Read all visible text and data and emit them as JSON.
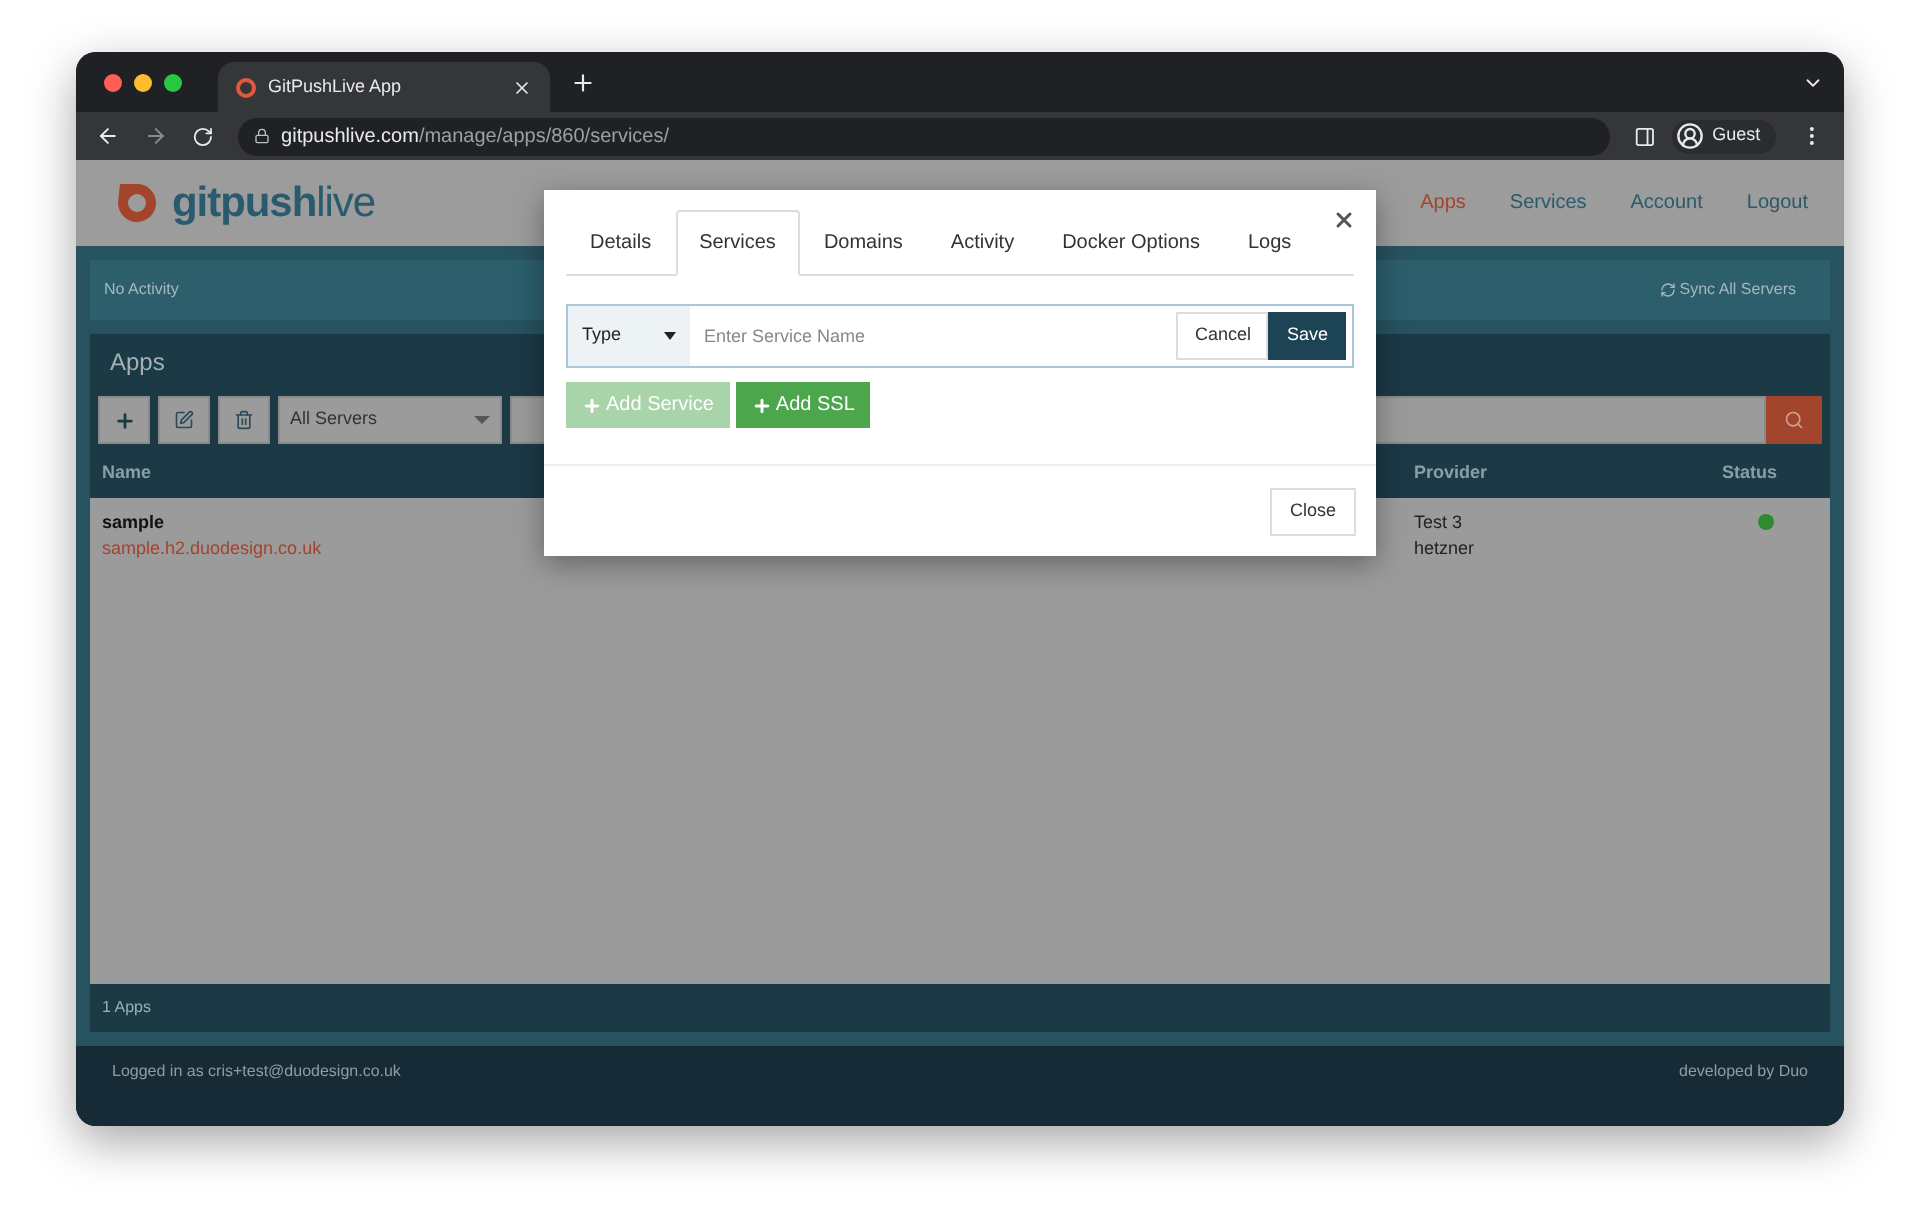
{
  "browser": {
    "tab_title": "GitPushLive App",
    "url_host": "gitpushlive.com",
    "url_path": "/manage/apps/860/services/",
    "profile": "Guest"
  },
  "nav": {
    "logo_a": "gitpush",
    "logo_b": "live",
    "links": [
      {
        "label": "Apps",
        "selected": true
      },
      {
        "label": "Services",
        "selected": false
      },
      {
        "label": "Account",
        "selected": false
      },
      {
        "label": "Logout",
        "selected": false
      }
    ]
  },
  "activity_bar": {
    "message": "No Activity",
    "sync": "Sync All Servers"
  },
  "panel": {
    "title": "Apps",
    "server_filter": "All Servers",
    "columns": [
      "Name",
      "Provider",
      "Status"
    ],
    "rows": [
      {
        "name": "sample",
        "url": "sample.h2.duodesign.co.uk",
        "provider": "Test 3",
        "provider_type": "hetzner",
        "color": "#2e8b2e"
      }
    ],
    "count": "1 Apps"
  },
  "footer": {
    "logged_in": "Logged in as cris+test@duodesign.co.uk",
    "credit": "developed by Duo"
  },
  "modal": {
    "tabs": [
      {
        "label": "Details",
        "selected": false
      },
      {
        "label": "Services",
        "selected": true
      },
      {
        "label": "Domains",
        "selected": false
      },
      {
        "label": "Activity",
        "selected": false
      },
      {
        "label": "Docker Options",
        "selected": false
      },
      {
        "label": "Logs",
        "selected": false
      }
    ],
    "type_select": "Type",
    "name_placeholder": "Enter Service Name",
    "cancel": "Cancel",
    "save": "Save",
    "actions": [
      {
        "label": "Add Service",
        "disabled": true
      },
      {
        "label": "Add SSL",
        "disabled": false
      }
    ],
    "close": "Close"
  }
}
